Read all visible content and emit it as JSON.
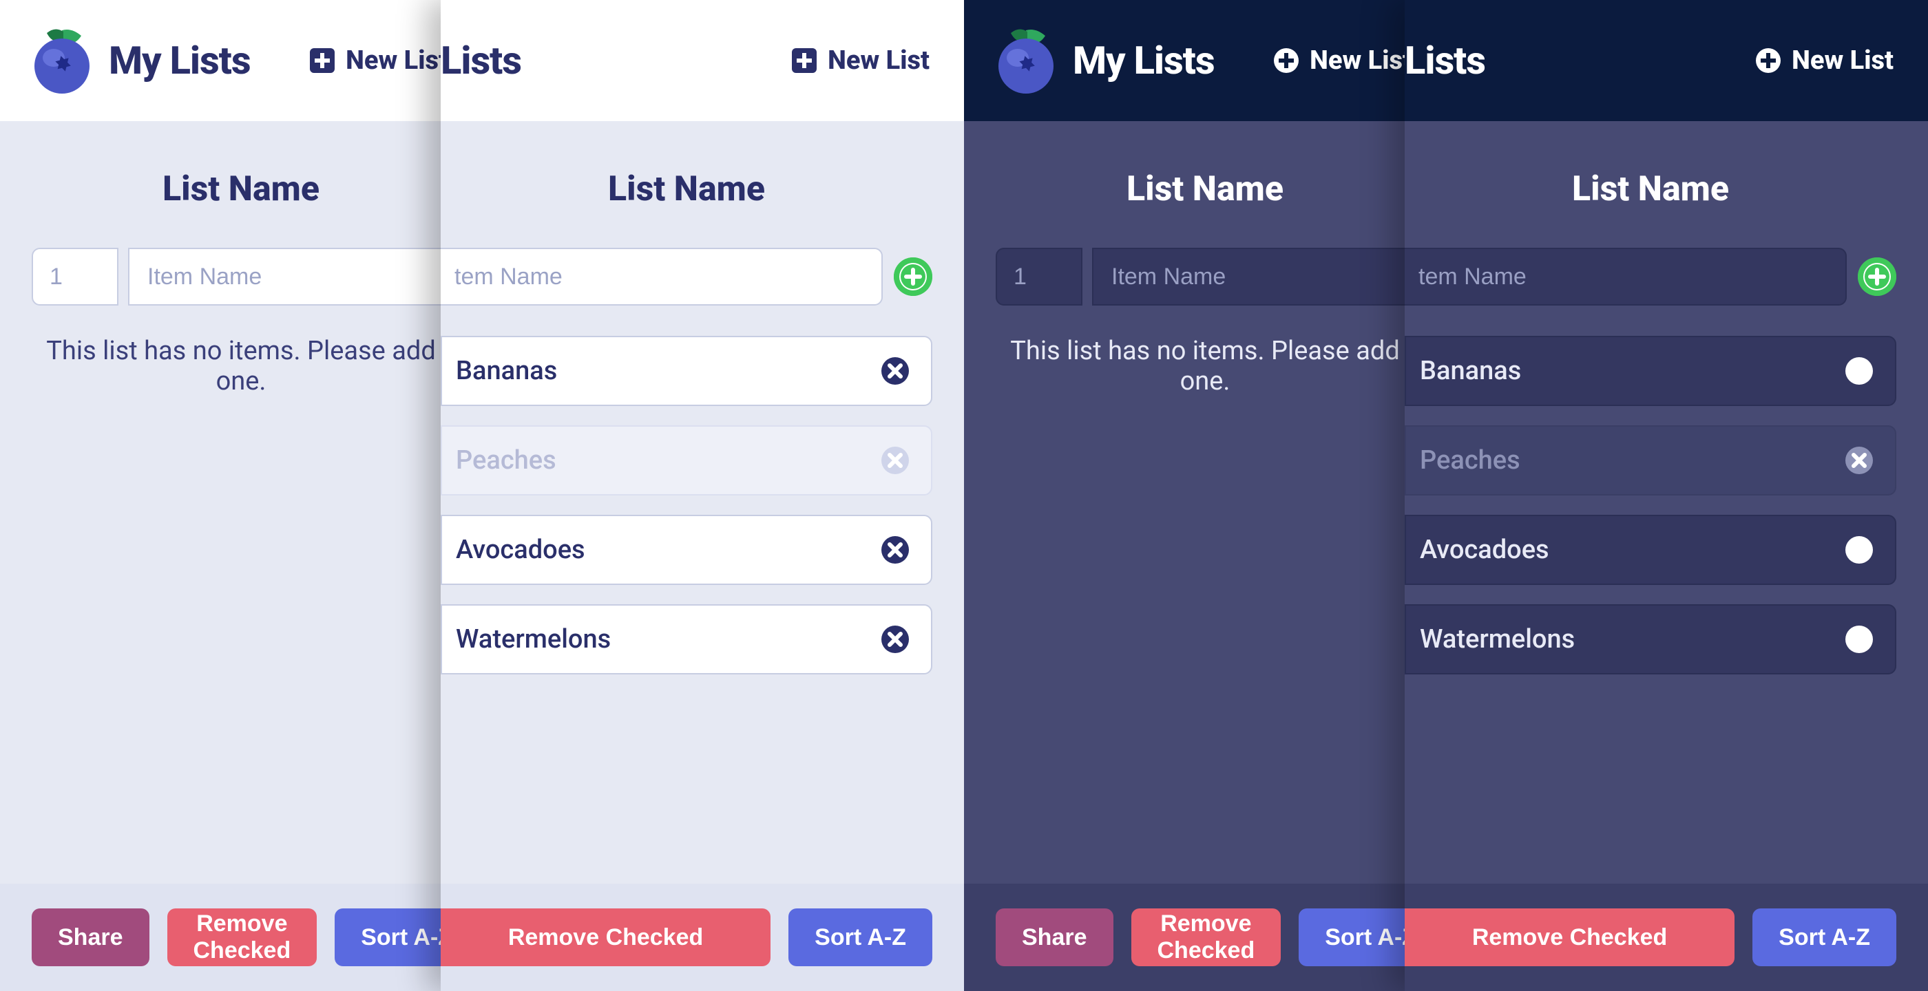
{
  "header": {
    "title": "My Lists",
    "title_cropped": "Lists",
    "newlist_label": "New List"
  },
  "list": {
    "title": "List Name",
    "qty_placeholder": "1",
    "name_placeholder": "Item Name",
    "name_placeholder_cropped": "tem Name",
    "empty_message": "This list has no items. Please add one."
  },
  "items": [
    {
      "label": "Bananas",
      "checked": false
    },
    {
      "label": "Peaches",
      "checked": true
    },
    {
      "label": "Avocadoes",
      "checked": false
    },
    {
      "label": "Watermelons",
      "checked": false
    }
  ],
  "footer": {
    "share": "Share",
    "remove": "Remove Checked",
    "sort": "Sort A-Z"
  },
  "colors": {
    "accent_add": "#3fc95a",
    "accent_share": "#a14b7d",
    "accent_remove": "#e85f6f",
    "accent_sort": "#5a6ae0",
    "remove_icon_light": "#2a2f6a",
    "remove_icon_dark": "#ffffff"
  }
}
